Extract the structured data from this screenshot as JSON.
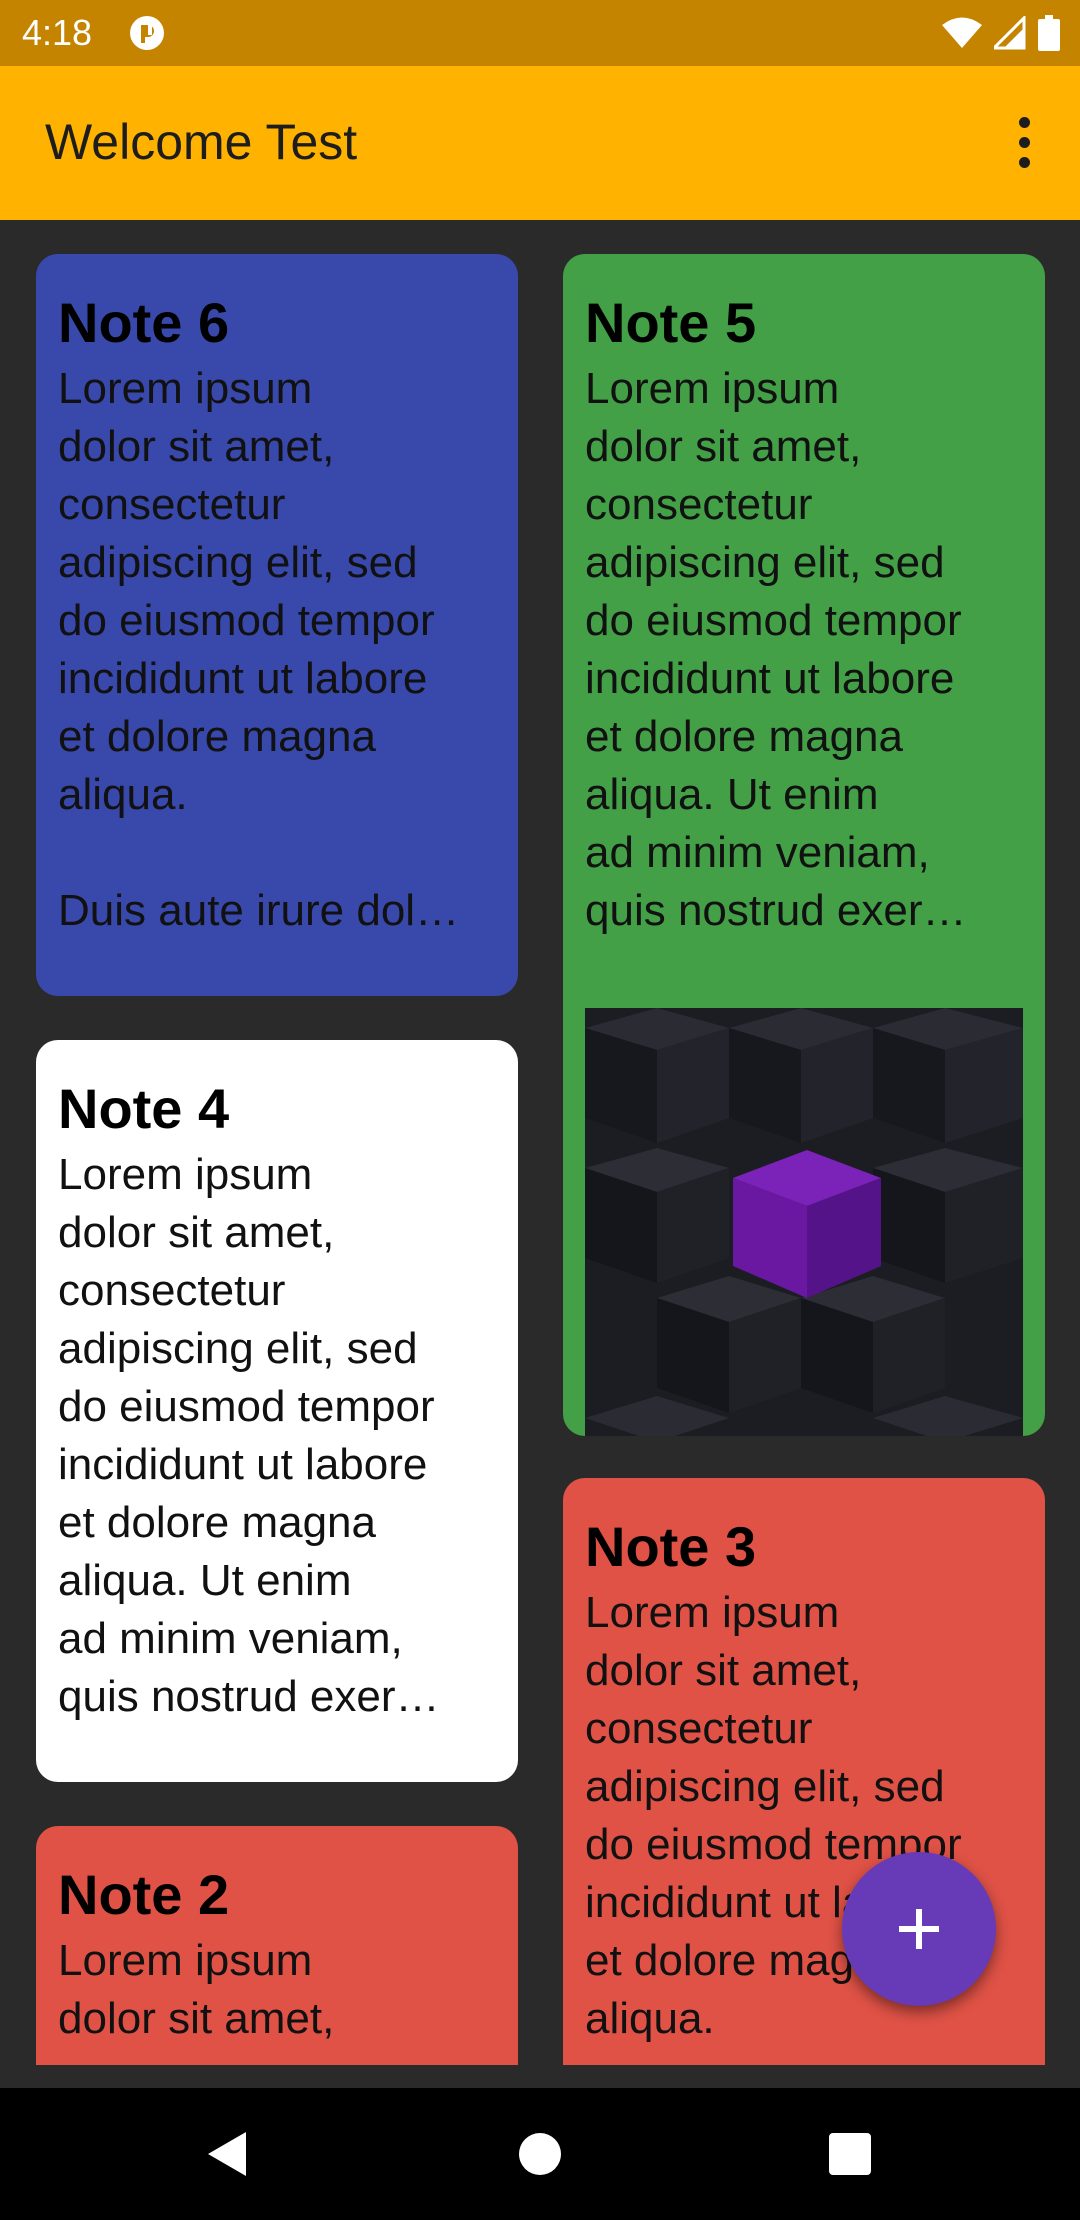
{
  "status_bar": {
    "time": "4:18",
    "notification_icon": "app-notification-icon",
    "icons": [
      "wifi-icon",
      "cell-signal-icon",
      "battery-icon"
    ]
  },
  "app_bar": {
    "title": "Welcome Test",
    "menu_icon": "more-vert-icon"
  },
  "notes": [
    {
      "id": "note6",
      "title": "Note 6",
      "body": "Lorem ipsum\ndolor sit amet,\nconsectetur\nadipiscing elit, sed\ndo eiusmod tempor\nincididunt ut labore\net dolore magna\naliqua.\n\nDuis aute irure dol…",
      "color": "#3949ab"
    },
    {
      "id": "note5",
      "title": "Note 5",
      "body": "Lorem ipsum\ndolor sit amet,\nconsectetur\nadipiscing elit, sed\ndo eiusmod tempor\nincididunt ut labore\net dolore magna\naliqua. Ut enim\nad minim veniam,\nquis nostrud exer…",
      "color": "#43a047",
      "image": "dark-cubes-purple-cube-image"
    },
    {
      "id": "note4",
      "title": "Note 4",
      "body": "Lorem ipsum\ndolor sit amet,\nconsectetur\nadipiscing elit, sed\ndo eiusmod tempor\nincididunt ut labore\net dolore magna\naliqua. Ut enim\nad minim veniam,\nquis nostrud exer…",
      "color": "#ffffff"
    },
    {
      "id": "note3",
      "title": "Note 3",
      "body": "Lorem ipsum\ndolor sit amet,\nconsectetur\nadipiscing elit, sed\ndo eiusmod tempor\nincididunt ut labore\net dolore magna\naliqua.",
      "color": "#e05246"
    },
    {
      "id": "note2",
      "title": "Note 2",
      "body": "Lorem ipsum\ndolor sit amet,",
      "color": "#e05246"
    }
  ],
  "fab": {
    "icon": "add-icon",
    "color": "#673ab7"
  },
  "nav_bar": {
    "buttons": [
      "back-icon",
      "home-icon",
      "recents-icon"
    ]
  },
  "colors": {
    "status_bar": "#c48400",
    "app_bar": "#ffb300",
    "background": "#2a2a2a"
  }
}
